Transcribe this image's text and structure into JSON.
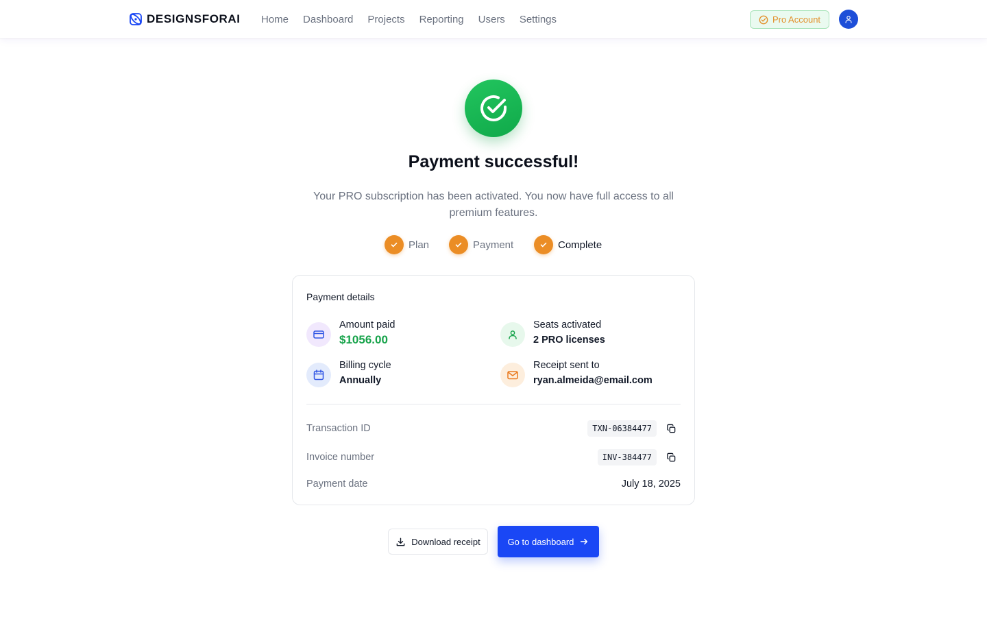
{
  "header": {
    "brand": "DESIGNSFORAI",
    "nav": [
      "Home",
      "Dashboard",
      "Projects",
      "Reporting",
      "Users",
      "Settings"
    ],
    "badge": "Pro Account"
  },
  "hero": {
    "title": "Payment successful!",
    "subtitle": "Your PRO subscription has been activated. You now have full access to all premium features."
  },
  "steps": [
    {
      "label": "Plan",
      "state": "done"
    },
    {
      "label": "Payment",
      "state": "done"
    },
    {
      "label": "Complete",
      "state": "current"
    }
  ],
  "details": {
    "title": "Payment details",
    "amount": {
      "label": "Amount paid",
      "value": "$1056.00"
    },
    "seats": {
      "label": "Seats activated",
      "value": "2 PRO licenses"
    },
    "cycle": {
      "label": "Billing cycle",
      "value": "Annually"
    },
    "receipt": {
      "label": "Receipt sent to",
      "value": "ryan.almeida@email.com"
    },
    "transaction": {
      "label": "Transaction ID",
      "value": "TXN-06384477"
    },
    "invoice": {
      "label": "Invoice number",
      "value": "INV-384477"
    },
    "date": {
      "label": "Payment date",
      "value": "July 18, 2025"
    }
  },
  "actions": {
    "download": "Download receipt",
    "dashboard": "Go to dashboard"
  },
  "colors": {
    "accent_blue": "#1a47f5",
    "success_green": "#16a34a",
    "step_orange": "#eb8d25",
    "badge_text": "#e2902a"
  },
  "icons": {
    "brand": "atom-logo-icon",
    "badge": "check-circle-icon",
    "avatar": "user-icon",
    "success": "check-circle-icon",
    "amount": "credit-card-icon",
    "seats": "user-icon",
    "cycle": "calendar-icon",
    "receipt": "mail-icon",
    "copy": "copy-icon",
    "download": "download-icon",
    "arrow": "arrow-right-icon"
  }
}
